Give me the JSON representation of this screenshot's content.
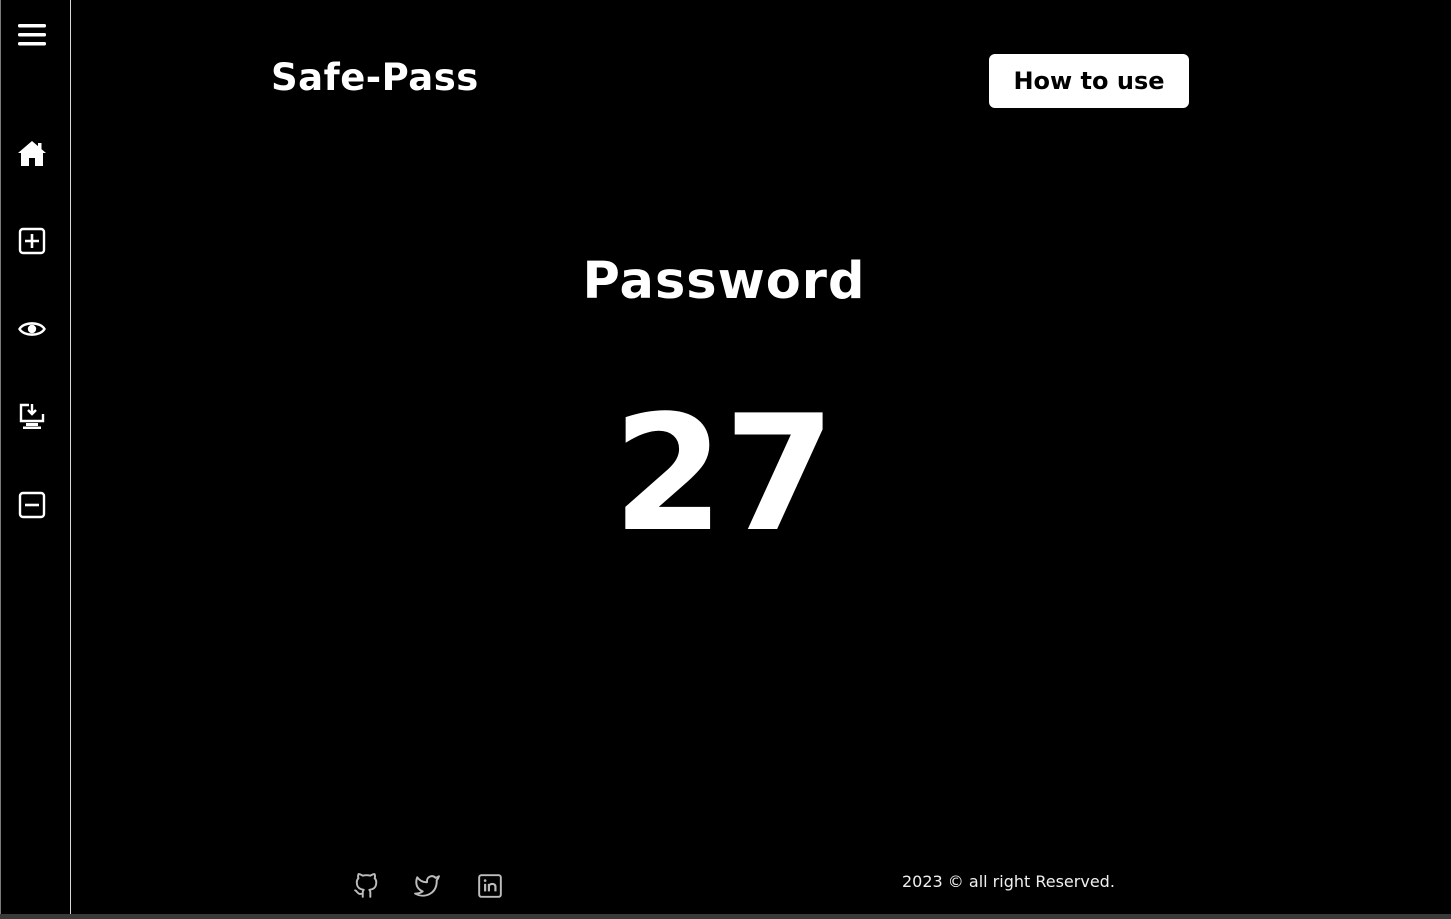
{
  "sidebar": {
    "items": [
      {
        "icon": "menu-icon"
      },
      {
        "icon": "home-icon"
      },
      {
        "icon": "add-square-icon"
      },
      {
        "icon": "eye-icon"
      },
      {
        "icon": "download-monitor-icon"
      },
      {
        "icon": "minus-square-icon"
      }
    ]
  },
  "header": {
    "brand": "Safe-Pass",
    "how_to_use_label": "How to use"
  },
  "main": {
    "heading": "Password",
    "count": "27"
  },
  "footer": {
    "social": [
      {
        "icon": "github-icon"
      },
      {
        "icon": "twitter-icon"
      },
      {
        "icon": "linkedin-icon"
      }
    ],
    "copyright": "2023 © all right Reserved."
  },
  "colors": {
    "background": "#000000",
    "text": "#ffffff",
    "button_bg": "#ffffff",
    "button_text": "#000000",
    "social_icon": "#bdbdbd"
  }
}
